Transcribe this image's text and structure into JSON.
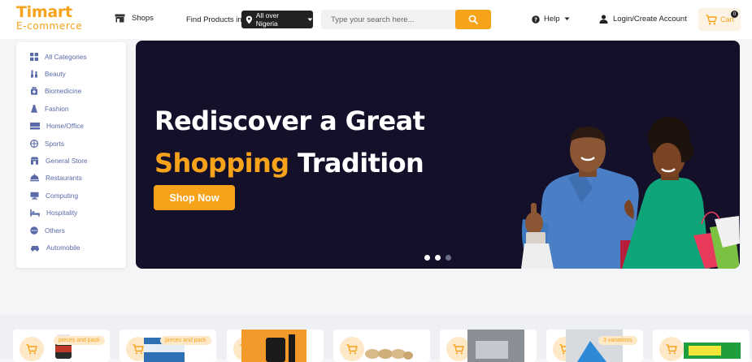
{
  "header": {
    "logo_main": "Timart",
    "logo_sub": "E-commerce",
    "shops_label": "Shops",
    "find_label": "Find Products in",
    "location_label": "All over Nigeria",
    "search_placeholder": "Type your search here...",
    "help_label": "Help",
    "login_label": "Login/Create Account",
    "cart_label": "Cart",
    "cart_count": "0"
  },
  "sidebar": {
    "items": [
      {
        "label": "All Categories",
        "icon": "grid-icon"
      },
      {
        "label": "Beauty",
        "icon": "beauty-icon"
      },
      {
        "label": "Biomedicine",
        "icon": "medicine-icon"
      },
      {
        "label": "Fashion",
        "icon": "fashion-icon"
      },
      {
        "label": "Home/Office",
        "icon": "home-office-icon"
      },
      {
        "label": "Sports",
        "icon": "sports-icon"
      },
      {
        "label": "General Store",
        "icon": "store-icon"
      },
      {
        "label": "Restaurants",
        "icon": "restaurant-icon"
      },
      {
        "label": "Computing",
        "icon": "computing-icon"
      },
      {
        "label": "Hospitality",
        "icon": "hospitality-icon"
      },
      {
        "label": "Others",
        "icon": "others-icon"
      },
      {
        "label": "Automobile",
        "icon": "automobile-icon"
      }
    ]
  },
  "hero": {
    "title_line1": "Rediscover a Great",
    "title_accent": "Shopping",
    "title_rest": " Tradition",
    "cta_label": "Shop Now",
    "slide_count": 3,
    "active_slide": 2
  },
  "products": {
    "tags": [
      "pieces and pack",
      "pieces and pack",
      "3 variations"
    ]
  },
  "colors": {
    "accent": "#f7a21b",
    "hero_bg": "#15102a",
    "category_text": "#5a6aa8"
  }
}
